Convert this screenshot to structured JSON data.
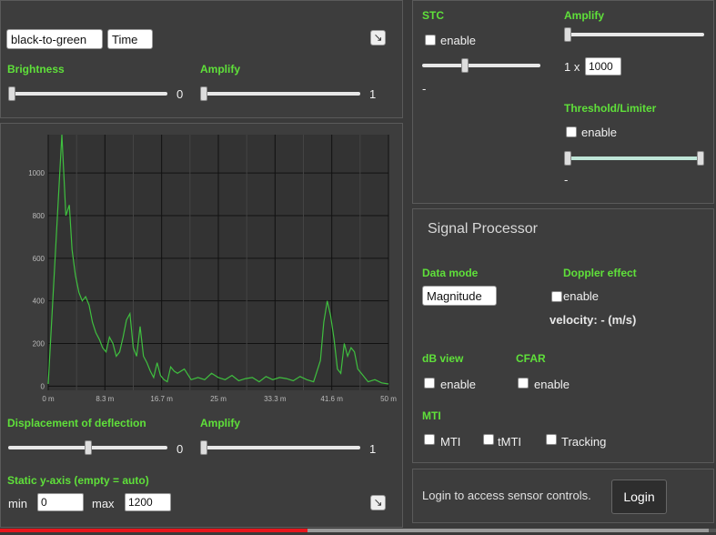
{
  "display": {
    "color_map": "black-to-green",
    "mode": "Time",
    "brightness_label": "Brightness",
    "brightness_value": "0",
    "brightness_level": 0.0,
    "amplify_label": "Amplify",
    "amplify_value": "1",
    "amplify_level": 0.0
  },
  "stc": {
    "title": "STC",
    "enable_label": "enable",
    "slider_level": 0.35,
    "value_text": "-",
    "amplify_label": "Amplify",
    "amplify_level": 0.0,
    "multiplier_prefix": "1 x",
    "multiplier_value": "1000",
    "threshold_title": "Threshold/Limiter",
    "threshold_enable_label": "enable",
    "threshold_range": [
      0.0,
      1.0
    ],
    "threshold_value_text": "-"
  },
  "chart_data": {
    "type": "line",
    "title": "",
    "xlabel": "",
    "ylabel": "",
    "x_ticks": [
      "0 m",
      "8.3 m",
      "16.7 m",
      "25 m",
      "33.3 m",
      "41.6 m",
      "50 m"
    ],
    "y_ticks": [
      "0",
      "200",
      "400",
      "600",
      "800",
      "1000"
    ],
    "xlim": [
      0,
      50
    ],
    "ylim": [
      -20,
      1180
    ],
    "grid": true,
    "line_color": "#3fbf3f",
    "series": [
      {
        "x": [
          0,
          2.0,
          2.6,
          3.1,
          3.5,
          4.0,
          4.5,
          5.0,
          5.5,
          6.0,
          6.5,
          7.0,
          7.5,
          8.0,
          8.5,
          9.0,
          9.5,
          10.0,
          10.5,
          11.0,
          11.5,
          12.0,
          12.5,
          13.0,
          13.5,
          14.0,
          14.5,
          15.0,
          15.5,
          16.0,
          16.5,
          17.0,
          17.5,
          18.0,
          18.5,
          19.0,
          20.0,
          21.0,
          22.0,
          23.0,
          24.0,
          25.0,
          26.0,
          27.0,
          28.0,
          29.0,
          30.0,
          31.0,
          32.0,
          33.0,
          34.0,
          35.0,
          36.0,
          37.0,
          38.0,
          39.0,
          40.0,
          40.5,
          41.0,
          41.5,
          42.0,
          42.5,
          43.0,
          43.5,
          44.0,
          44.5,
          45.0,
          45.5,
          46.0,
          46.5,
          47.0,
          48.0,
          49.0,
          50.0
        ],
        "y": [
          10,
          1180,
          800,
          850,
          640,
          520,
          440,
          400,
          420,
          380,
          300,
          250,
          220,
          180,
          160,
          230,
          200,
          140,
          160,
          230,
          310,
          340,
          180,
          140,
          280,
          140,
          110,
          70,
          40,
          110,
          50,
          30,
          20,
          90,
          70,
          60,
          80,
          30,
          40,
          30,
          60,
          40,
          30,
          50,
          25,
          35,
          40,
          20,
          45,
          30,
          40,
          35,
          25,
          45,
          30,
          20,
          120,
          300,
          400,
          330,
          220,
          80,
          60,
          200,
          140,
          180,
          160,
          80,
          60,
          40,
          20,
          30,
          15,
          10
        ]
      }
    ]
  },
  "deflection": {
    "label": "Displacement of deflection",
    "value": "0",
    "level": 0.5,
    "amplify_label": "Amplify",
    "amplify_value": "1",
    "amplify_level": 0.0
  },
  "yaxis": {
    "label": "Static y-axis (empty = auto)",
    "min_label": "min",
    "min_value": "0",
    "max_label": "max",
    "max_value": "1200"
  },
  "processor": {
    "title": "Signal Processor",
    "data_mode_label": "Data mode",
    "data_mode_value": "Magnitude",
    "doppler_label": "Doppler effect",
    "doppler_enable_label": "enable",
    "velocity_text": "velocity: - (m/s)",
    "db_view_label": "dB view",
    "db_enable_label": "enable",
    "cfar_label": "CFAR",
    "cfar_enable_label": "enable",
    "mti_title": "MTI",
    "mti_label": "MTI",
    "tmti_label": "tMTI",
    "tracking_label": "Tracking"
  },
  "login": {
    "message": "Login to access sensor controls.",
    "button_label": "Login"
  },
  "progress": {
    "played_fraction": 0.43,
    "buffered_fraction": 0.99,
    "played_color": "#e8161d"
  }
}
